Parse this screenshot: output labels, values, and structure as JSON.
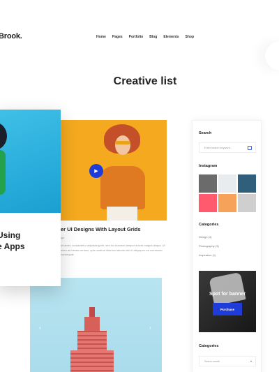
{
  "header": {
    "logo": "Brook.",
    "nav": [
      "Home",
      "Pages",
      "Portfolio",
      "Blog",
      "Elements",
      "Shop"
    ]
  },
  "page_title": "Creative list",
  "floating_card": {
    "title_line1": "Using",
    "title_line2": "e Apps"
  },
  "posts": [
    {
      "title": "er UI Designs With Layout Grids",
      "meta": "ign",
      "excerpt": "sit amet, consectetur adipiscing elit, sed do eiusmod tempor dolore magna aliqua. Ut enim ad minim veniam, quis nostrud ullamco laboris nisi ut aliquip ex ea commodo consequat."
    }
  ],
  "icons": {
    "play": "play-icon",
    "prev": "chevron-left-icon",
    "next": "chevron-right-icon",
    "search": "search-icon"
  },
  "slider_arrows": {
    "prev": "‹",
    "next": "›"
  },
  "play_glyph": "▶",
  "sidebar": {
    "search_heading": "Search",
    "search_placeholder": "Enter search keyword...",
    "instagram_heading": "Instagram",
    "instagram_colors": [
      "#6b6b6b",
      "#e9ecef",
      "#2f5f7a",
      "#ff5a6e",
      "#f7a25a",
      "#cfcfcf"
    ],
    "categories_heading": "Categories",
    "categories": [
      "Design (4)",
      "Photography (3)",
      "Inspiration (1)"
    ],
    "banner_text": "Spot for banner",
    "banner_button": "Purchase",
    "categories_heading_2": "Categories",
    "select_placeholder": "Select month",
    "select_caret": "▾"
  },
  "colors": {
    "accent": "#1f3bd8",
    "post_bg": "#f4a91e",
    "floating_bg": "#1a9fd1",
    "slider_bg": "#b8e4f0"
  }
}
